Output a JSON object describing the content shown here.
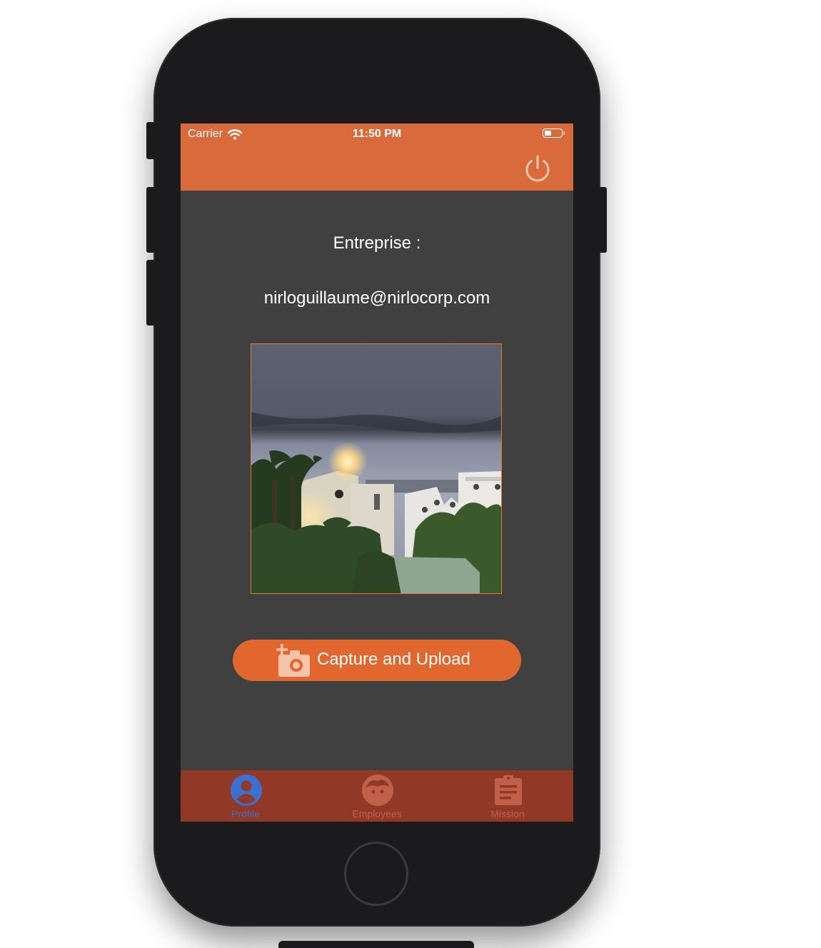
{
  "status_bar": {
    "carrier": "Carrier",
    "time": "11:50 PM",
    "battery_level": 0.45
  },
  "header": {
    "logout_icon": "power-icon"
  },
  "profile": {
    "company_label": "Entreprise :",
    "email": "nirloguillaume@nirlocorp.com"
  },
  "actions": {
    "capture_upload_label": "Capture and Upload",
    "capture_upload_icon": "add-camera-icon"
  },
  "tab_bar": {
    "tabs": [
      {
        "label": "Profile",
        "icon": "person-icon",
        "selected": true
      },
      {
        "label": "Employees",
        "icon": "face-icon",
        "selected": false
      },
      {
        "label": "Mission",
        "icon": "clipboard-icon",
        "selected": false
      }
    ]
  },
  "colors": {
    "brand_orange": "#d96a3b",
    "button_orange": "#e1672e",
    "tab_bar_background": "#923827",
    "tab_selected": "#3b6fd0",
    "tab_unselected": "#c0604a",
    "screen_background": "#404041"
  }
}
